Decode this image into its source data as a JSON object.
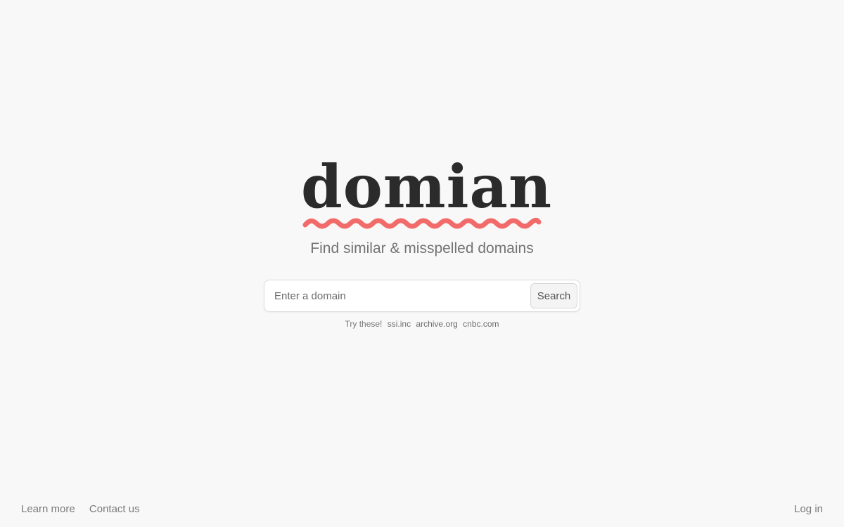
{
  "brand": {
    "logo_text": "domian",
    "tagline": "Find similar & misspelled domains",
    "accent_color": "#f26b6b"
  },
  "search": {
    "placeholder": "Enter a domain",
    "value": "",
    "button_label": "Search"
  },
  "suggestions": {
    "label": "Try these!",
    "items": [
      "ssi.inc",
      "archive.org",
      "cnbc.com"
    ]
  },
  "footer": {
    "learn_more": "Learn more",
    "contact_us": "Contact us",
    "log_in": "Log in"
  }
}
